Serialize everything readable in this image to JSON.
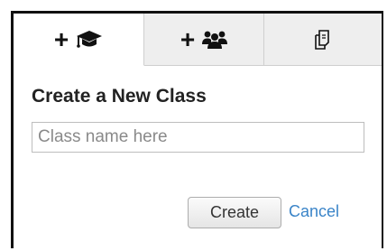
{
  "tabs": [
    {
      "prefix": "+",
      "icon": "graduation-cap-icon",
      "active": true
    },
    {
      "prefix": "+",
      "icon": "users-icon",
      "active": false
    },
    {
      "prefix": "",
      "icon": "copy-icon",
      "active": false
    }
  ],
  "form": {
    "heading": "Create a New Class",
    "input_placeholder": "Class name here",
    "input_value": "",
    "create_label": "Create",
    "cancel_label": "Cancel"
  },
  "colors": {
    "link": "#3a84c8",
    "border": "#111111",
    "inactive_tab": "#eeeeee"
  }
}
